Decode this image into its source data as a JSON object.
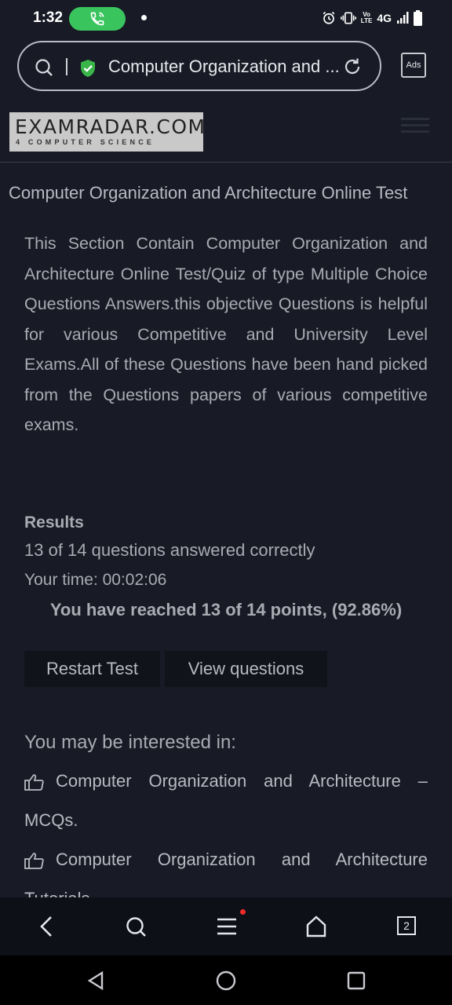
{
  "status_bar": {
    "time": "1:32",
    "network": "4G"
  },
  "browser": {
    "url_text": "Computer Organization and ...",
    "ads_label": "Ads"
  },
  "site": {
    "logo_main": "EXAMRADAR.COM",
    "logo_sub": "4 COMPUTER SCIENCE"
  },
  "page": {
    "title": "Computer Organization and Architecture Online Test",
    "description": "This Section Contain Computer Organization and Architecture Online Test/Quiz of type Multiple Choice Questions Answers.this objective Questions is helpful for various Competitive and University Level Exams.All of these Questions have been hand picked from the Questions papers of various competitive exams."
  },
  "results": {
    "heading": "Results",
    "answered": "13 of 14 questions answered correctly",
    "time": "Your time: 00:02:06",
    "points": "You have reached 13 of 14 points, (92.86%)",
    "restart_label": "Restart Test",
    "view_label": "View questions"
  },
  "related": {
    "heading": "You may be interested in:",
    "links": [
      "Computer Organization and Architecture – MCQs.",
      "Computer Organization and Architecture Tutorials"
    ]
  },
  "bottom_nav": {
    "tab_count": "2"
  },
  "colors": {
    "background": "#181a25",
    "accent_green": "#3ac45e",
    "notification_red": "#ef2b2b"
  }
}
